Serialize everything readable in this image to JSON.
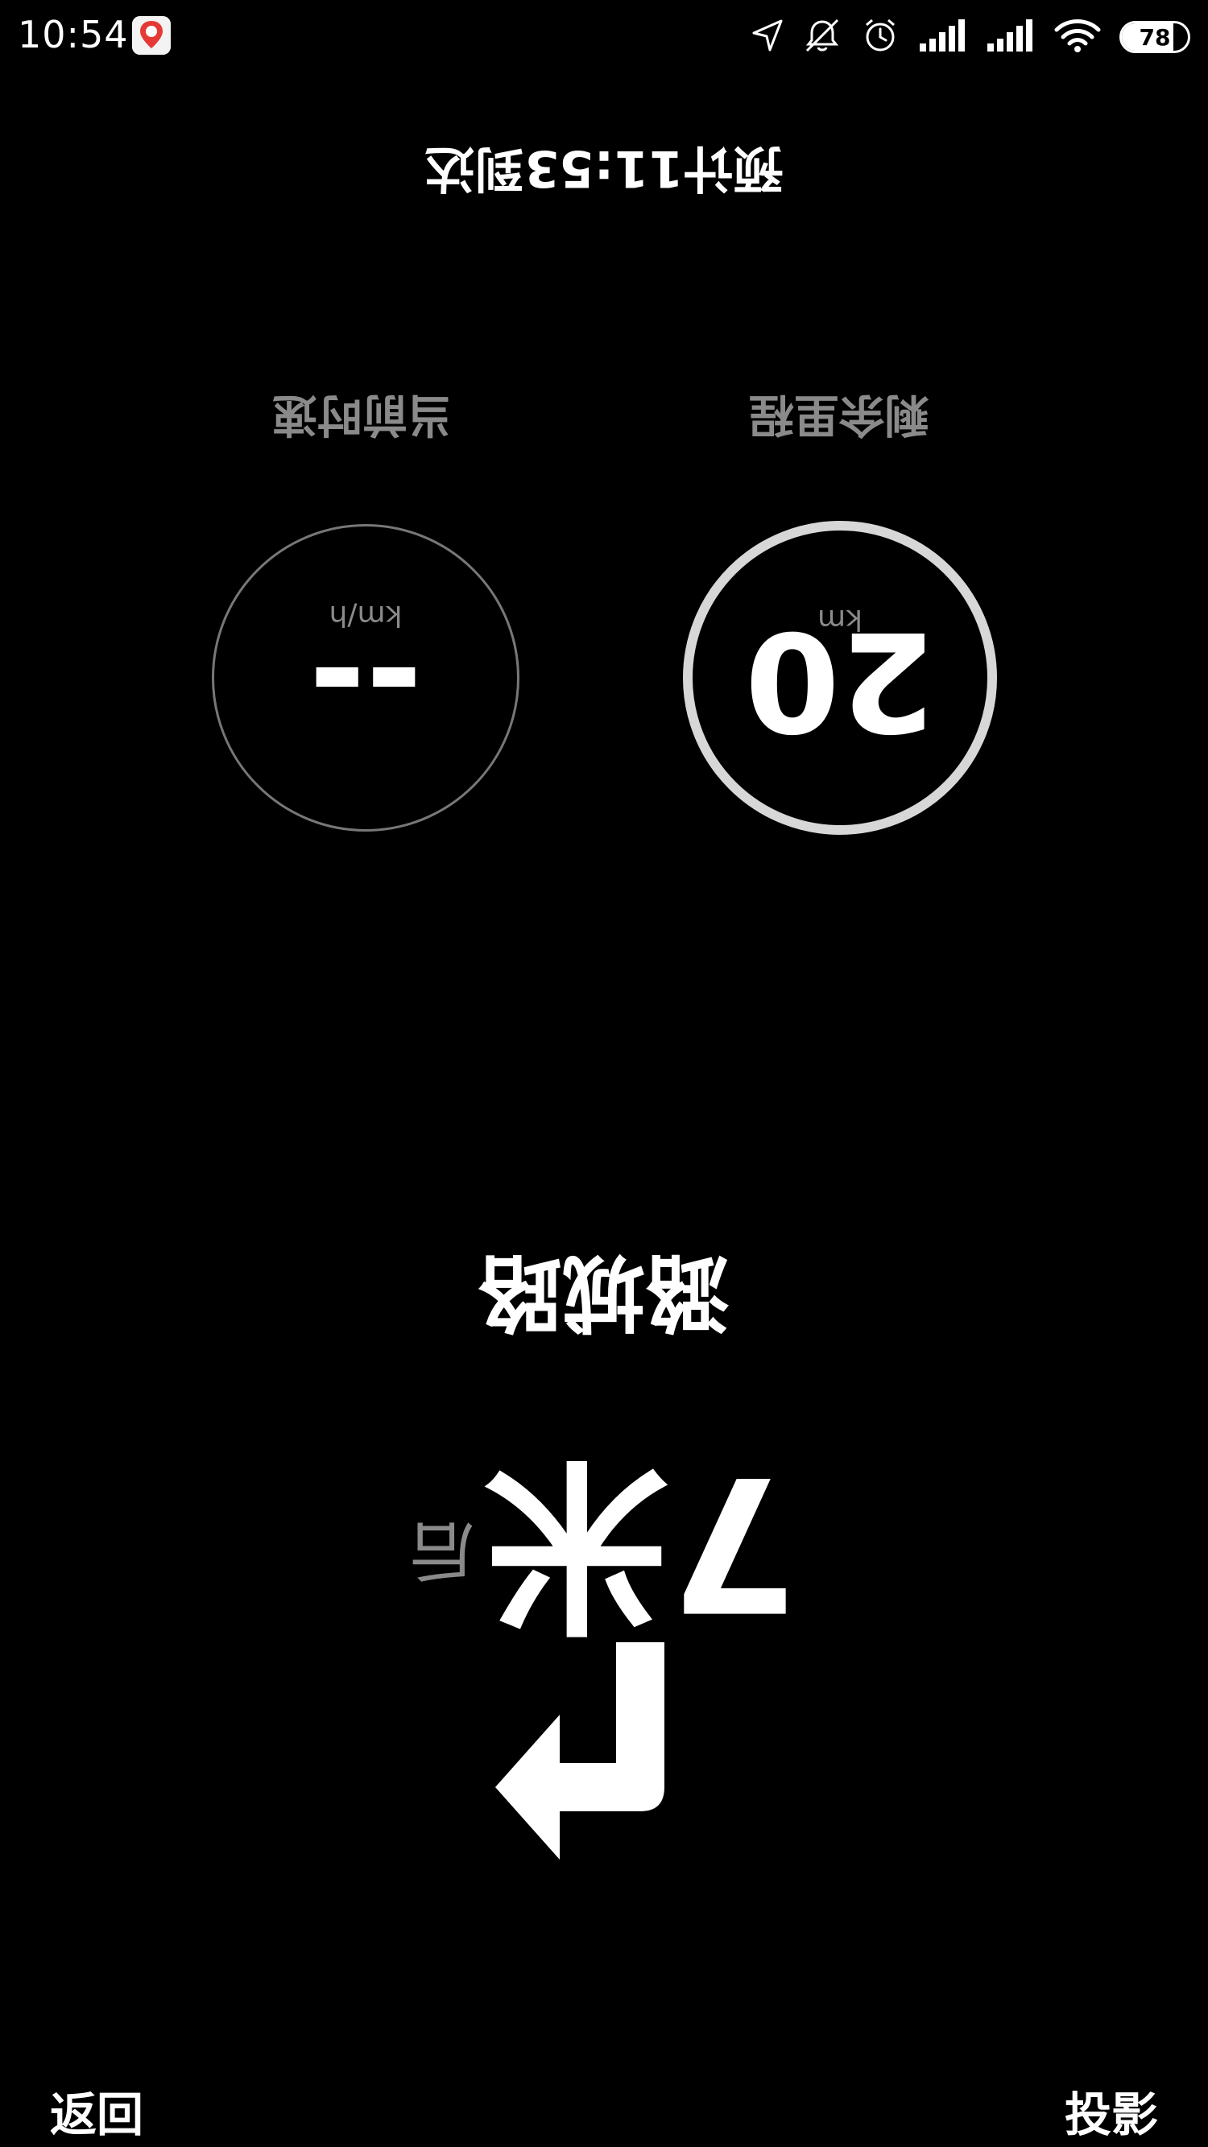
{
  "status_bar": {
    "time": "10:54",
    "app_icon": "baidu-maps-icon",
    "icons": [
      "location-arrow-icon",
      "mute-bell-icon",
      "alarm-icon",
      "signal-icon",
      "signal-icon",
      "wifi-icon"
    ],
    "battery_level": "78",
    "battery_fraction": 0.78
  },
  "hud": {
    "turn_icon": "turn-right-arrow-icon",
    "distance_value": "7米",
    "distance_suffix": "后",
    "road_name": "潞城路",
    "gauges": {
      "speed": {
        "value": "--",
        "unit": "km/h",
        "caption": "当前时速"
      },
      "remaining": {
        "value": "20",
        "unit": "km",
        "caption": "剩余里程"
      }
    },
    "eta": "预计11:53到达"
  },
  "bottom_bar": {
    "back_label": "返回",
    "project_label": "投影"
  },
  "colors": {
    "background": "#000000",
    "foreground": "#ffffff",
    "muted": "#8a8a8a",
    "ring": "#d7d7d7"
  }
}
